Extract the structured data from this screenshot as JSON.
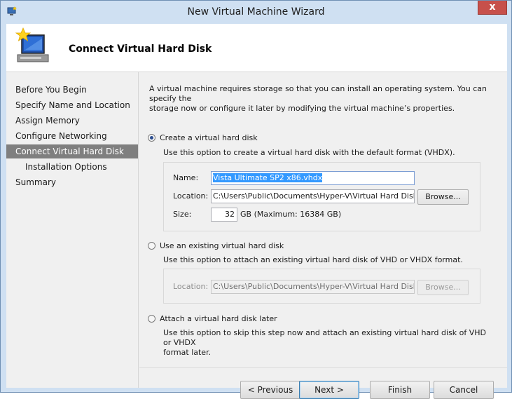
{
  "window": {
    "title": "New Virtual Machine Wizard",
    "close_glyph": "x",
    "app_icon": "hyper-v-icon"
  },
  "header": {
    "icon": "computer-star-icon",
    "title": "Connect Virtual Hard Disk"
  },
  "nav": {
    "items": [
      {
        "label": "Before You Begin"
      },
      {
        "label": "Specify Name and Location"
      },
      {
        "label": "Assign Memory"
      },
      {
        "label": "Configure Networking"
      },
      {
        "label": "Connect Virtual Hard Disk"
      },
      {
        "label": "Installation Options"
      },
      {
        "label": "Summary"
      }
    ],
    "selected_index": 4
  },
  "content": {
    "intro_line1": "A virtual machine requires storage so that you can install an operating system. You can specify the",
    "intro_line2": "storage now or configure it later by modifying the virtual machine’s properties.",
    "option_create": {
      "label": "Create a virtual hard disk",
      "desc": "Use this option to create a virtual hard disk with the default format (VHDX).",
      "selected": true,
      "name_label": "Name:",
      "name_value": "Vista Ultimate SP2 x86.vhdx",
      "location_label": "Location:",
      "location_value": "C:\\Users\\Public\\Documents\\Hyper-V\\Virtual Hard Disks\\",
      "browse_label": "Browse...",
      "size_label": "Size:",
      "size_value": "32",
      "size_unit": "GB (Maximum: 16384 GB)"
    },
    "option_existing": {
      "label": "Use an existing virtual hard disk",
      "desc": "Use this option to attach an existing virtual hard disk of VHD or VHDX format.",
      "selected": false,
      "location_label": "Location:",
      "location_value": "C:\\Users\\Public\\Documents\\Hyper-V\\Virtual Hard Disks\\",
      "browse_label": "Browse..."
    },
    "option_later": {
      "label": "Attach a virtual hard disk later",
      "desc_line1": "Use this option to skip this step now and attach an existing virtual hard disk of VHD or VHDX",
      "desc_line2": "format later.",
      "selected": false
    }
  },
  "footer": {
    "previous_label": "< Previous",
    "next_label": "Next >",
    "finish_label": "Finish",
    "cancel_label": "Cancel"
  },
  "colors": {
    "frame": "#cfe0f2",
    "close_button": "#c7504b",
    "nav_selected": "#7f7f7f",
    "text_selection": "#3399ff"
  }
}
